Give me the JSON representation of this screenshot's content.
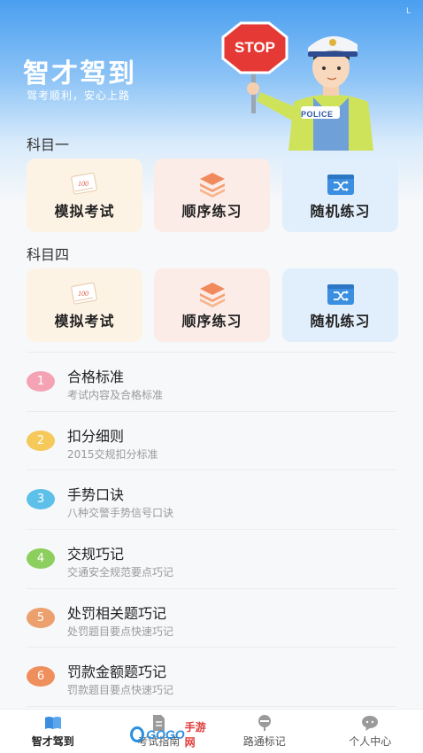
{
  "status_corner": "L",
  "header": {
    "title": "智才驾到",
    "slogan": "驾考顺利，安心上路",
    "stop_sign_text": "STOP",
    "police_badge_text": "POLICE"
  },
  "subject1": {
    "title": "科目一",
    "cards": [
      {
        "label": "模拟考试",
        "icon": "exam-paper-icon"
      },
      {
        "label": "顺序练习",
        "icon": "layers-icon"
      },
      {
        "label": "随机练习",
        "icon": "shuffle-icon"
      }
    ]
  },
  "subject4": {
    "title": "科目四",
    "cards": [
      {
        "label": "模拟考试",
        "icon": "exam-paper-icon"
      },
      {
        "label": "顺序练习",
        "icon": "layers-icon"
      },
      {
        "label": "随机练习",
        "icon": "shuffle-icon"
      }
    ]
  },
  "exam_paper_mark": "100",
  "list": [
    {
      "num": "1",
      "title": "合格标准",
      "subtitle": "考试内容及合格标准",
      "color": "#f4a3b4"
    },
    {
      "num": "2",
      "title": "扣分细则",
      "subtitle": "2015交规扣分标准",
      "color": "#f5c95a"
    },
    {
      "num": "3",
      "title": "手势口诀",
      "subtitle": "八种交警手势信号口诀",
      "color": "#5cc0e8"
    },
    {
      "num": "4",
      "title": "交规巧记",
      "subtitle": "交通安全规范要点巧记",
      "color": "#8ccf5e"
    },
    {
      "num": "5",
      "title": "处罚相关题巧记",
      "subtitle": "处罚题目要点快速巧记",
      "color": "#eba06e"
    },
    {
      "num": "6",
      "title": "罚款金额题巧记",
      "subtitle": "罚款题目要点快速巧记",
      "color": "#ee8f5c"
    }
  ],
  "nav": [
    {
      "label": "智才驾到",
      "icon": "book-icon",
      "active": true
    },
    {
      "label": "考试指南",
      "icon": "document-icon",
      "active": false
    },
    {
      "label": "路通标记",
      "icon": "road-sign-icon",
      "active": false
    },
    {
      "label": "个人中心",
      "icon": "chat-user-icon",
      "active": false
    }
  ],
  "watermark": {
    "latin": "GOGO",
    "cn": "手游网"
  },
  "colors": {
    "accent": "#4a9ff0",
    "card_mock": "#fdf3e5",
    "card_order": "#fcece8",
    "card_random": "#e1eefc"
  }
}
